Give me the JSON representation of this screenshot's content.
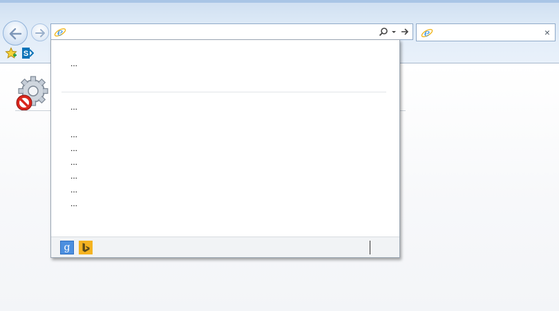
{
  "window": {
    "colors": {
      "chrome": "#dbe8f6",
      "accent": "#4c8fdf"
    }
  },
  "toolbar": {
    "back_icon": "arrow-left-icon",
    "forward_icon": "arrow-right-icon",
    "address": {
      "value": "",
      "placeholder": ""
    },
    "search_icon": "search-icon",
    "dropdown_icon": "chevron-down-icon",
    "go_icon": "arrow-right-icon"
  },
  "tab": {
    "title": "",
    "close_label": "×"
  },
  "favorites_bar": {
    "items": [
      {
        "icon": "favorites-star-icon"
      },
      {
        "icon": "sharepoint-icon"
      }
    ]
  },
  "content": {
    "icon": "blocked-settings-icon"
  },
  "dropdown": {
    "top_items": [
      "..."
    ],
    "items": [
      "...",
      "...",
      "...",
      "...",
      "...",
      "...",
      "..."
    ],
    "footer": {
      "providers": [
        "google",
        "bing"
      ],
      "google_label": "g"
    }
  }
}
